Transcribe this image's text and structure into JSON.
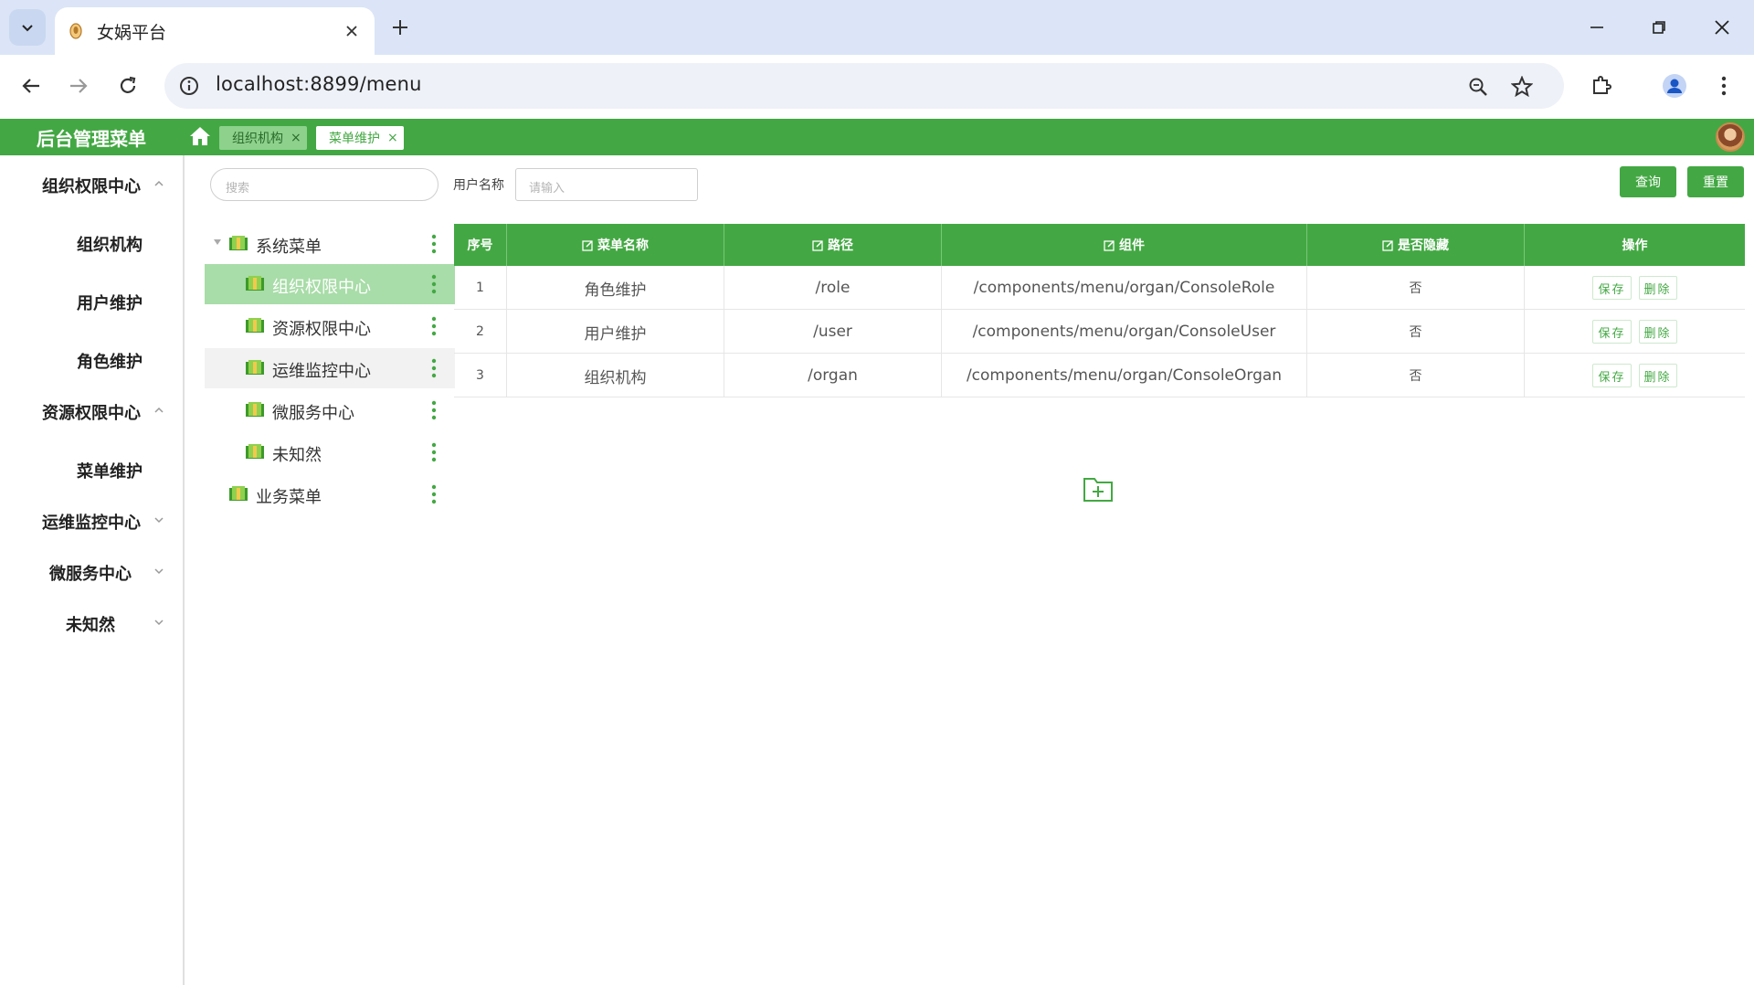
{
  "browser": {
    "tab_title": "女娲平台",
    "url": "localhost:8899/menu"
  },
  "app": {
    "brand": "后台管理菜单",
    "tabs": [
      {
        "label": "组织机构",
        "active": false
      },
      {
        "label": "菜单维护",
        "active": true
      }
    ],
    "accent_color": "#43a843"
  },
  "sidebar": {
    "items": [
      {
        "label": "组织权限中心",
        "level": 0,
        "expanded": true
      },
      {
        "label": "组织机构",
        "level": 1
      },
      {
        "label": "用户维护",
        "level": 1
      },
      {
        "label": "角色维护",
        "level": 1
      },
      {
        "label": "资源权限中心",
        "level": 0,
        "expanded": true
      },
      {
        "label": "菜单维护",
        "level": 1
      },
      {
        "label": "运维监控中心",
        "level": 0,
        "expanded": false
      },
      {
        "label": "微服务中心",
        "level": 0,
        "expanded": false
      },
      {
        "label": "未知然",
        "level": 0,
        "expanded": false
      }
    ]
  },
  "filters": {
    "search_placeholder": "搜索",
    "username_label": "用户名称",
    "username_placeholder": "请输入",
    "query_button": "查询",
    "reset_button": "重置"
  },
  "tree": {
    "nodes": [
      {
        "label": "系统菜单",
        "level": 0,
        "expanded": true
      },
      {
        "label": "组织权限中心",
        "level": 1,
        "selected": true
      },
      {
        "label": "资源权限中心",
        "level": 1
      },
      {
        "label": "运维监控中心",
        "level": 1,
        "hover": true
      },
      {
        "label": "微服务中心",
        "level": 1
      },
      {
        "label": "未知然",
        "level": 1
      },
      {
        "label": "业务菜单",
        "level": 0
      }
    ]
  },
  "table": {
    "columns": [
      "序号",
      "菜单名称",
      "路径",
      "组件",
      "是否隐藏",
      "操作"
    ],
    "rows": [
      {
        "index": "1",
        "name": "角色维护",
        "path": "/role",
        "component": "/components/menu/organ/ConsoleRole",
        "hidden": "否"
      },
      {
        "index": "2",
        "name": "用户维护",
        "path": "/user",
        "component": "/components/menu/organ/ConsoleUser",
        "hidden": "否"
      },
      {
        "index": "3",
        "name": "组织机构",
        "path": "/organ",
        "component": "/components/menu/organ/ConsoleOrgan",
        "hidden": "否"
      }
    ],
    "save_label": "保存",
    "delete_label": "删除"
  }
}
